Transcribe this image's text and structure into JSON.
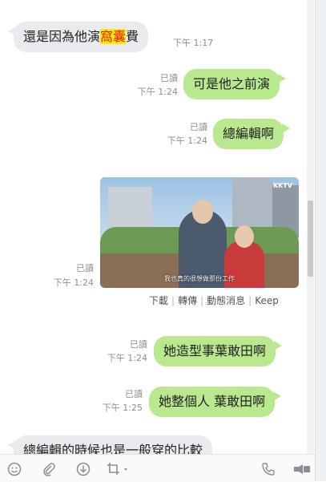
{
  "messages": [
    {
      "dir": "in",
      "text_pre": "還是因為他演",
      "text_hl": "窩囊",
      "text_post": "費",
      "time": "下午 1:17"
    },
    {
      "dir": "out",
      "text": "可是他之前演",
      "read": "已讀",
      "time": "下午 1:24"
    },
    {
      "dir": "out",
      "text": "總編輯啊",
      "read": "已讀",
      "time": "下午 1:24"
    },
    {
      "dir": "out",
      "type": "video",
      "read": "已讀",
      "time": "下午 1:24",
      "logo": "KKTV",
      "subtitle": "我也真的很想做那份工作"
    },
    {
      "dir": "out",
      "text": "她造型事葉敢田啊",
      "read": "已讀",
      "time": "下午 1:24"
    },
    {
      "dir": "out",
      "text": "她整個人 葉敢田啊",
      "read": "已讀",
      "time": "下午 1:25"
    },
    {
      "dir": "in",
      "text": "總編輯的時候也是一般穿的比較"
    }
  ],
  "video_actions": {
    "download": "下載",
    "forward": "轉傳",
    "timeline": "動態消息",
    "keep": "Keep"
  },
  "toolbar": {
    "icons": [
      "emoji-icon",
      "attachment-icon",
      "download-icon",
      "crop-icon",
      "phone-icon",
      "video-call-icon"
    ]
  },
  "colors": {
    "incoming_bubble": "#e9ebee",
    "outgoing_bubble": "#b9e88f",
    "highlight_bg": "#ffeb00",
    "highlight_text": "#e51e1e"
  }
}
